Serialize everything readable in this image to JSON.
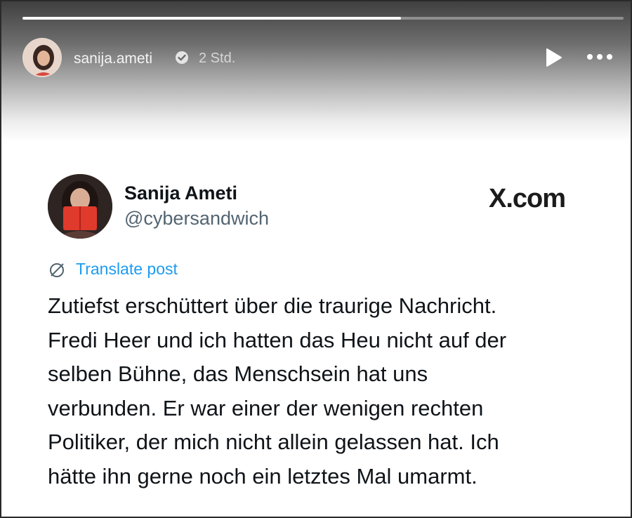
{
  "story": {
    "progress": 0.63,
    "username": "sanija.ameti",
    "verified_icon": "verified-check-icon",
    "time": "2 Std.",
    "play_icon": "play-icon",
    "more_icon": "more-options-icon"
  },
  "post": {
    "author_name": "Sanija Ameti",
    "author_handle": "@cybersandwich",
    "source_label": "X.com",
    "translate_icon": "translate-globe-icon",
    "translate_label": "Translate post",
    "text_lines": [
      "Zutiefst erschüttert über die traurige Nachricht.",
      "Fredi Heer und ich hatten das Heu nicht auf der",
      "selben Bühne, das Menschsein hat uns",
      "verbunden. Er war einer der wenigen rechten",
      "Politiker, der mich nicht allein gelassen hat. Ich",
      "hätte ihn gerne noch ein letztes Mal umarmt."
    ]
  },
  "colors": {
    "link": "#1d9bf0",
    "handle": "#536471",
    "text": "#0f1419"
  }
}
